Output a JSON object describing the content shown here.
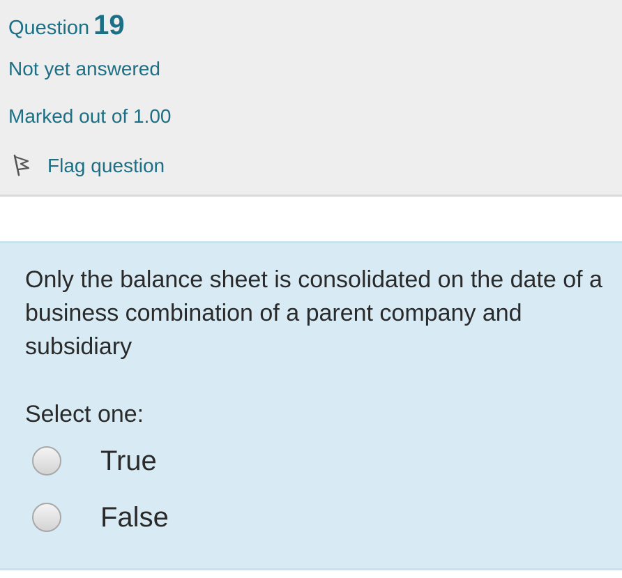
{
  "info": {
    "question_word": "Question",
    "question_number": "19",
    "state": "Not yet answered",
    "grade": "Marked out of 1.00",
    "flag_label": "Flag question",
    "flag_icon": "flag-icon",
    "accent_color": "#1c6f84"
  },
  "content": {
    "question_text": "Only the balance sheet is consolidated on the date of a business combination of a parent company and subsidiary",
    "prompt": "Select one:",
    "options": [
      {
        "label": "True",
        "selected": false
      },
      {
        "label": "False",
        "selected": false
      }
    ],
    "background_color": "#d8ebf5"
  }
}
